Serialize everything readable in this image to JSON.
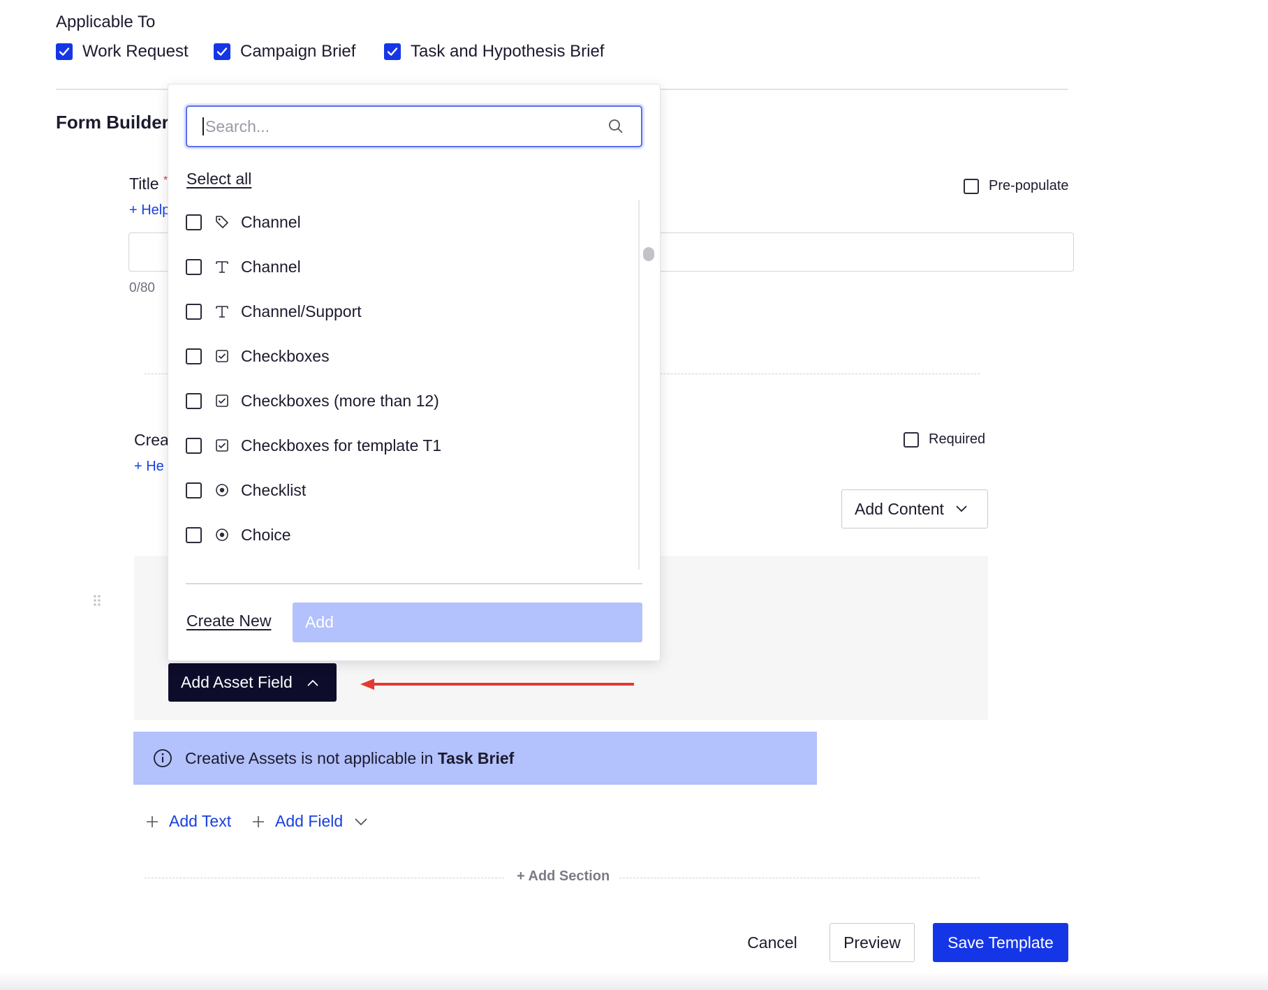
{
  "applicable_to": {
    "label": "Applicable To",
    "options": [
      {
        "label": "Work Request",
        "checked": true
      },
      {
        "label": "Campaign Brief",
        "checked": true
      },
      {
        "label": "Task and Hypothesis Brief",
        "checked": true
      }
    ]
  },
  "form_builder": {
    "title": "Form Builder",
    "title_field": {
      "label": "Title",
      "required_marker": "*",
      "help_link": "+ Help",
      "char_count": "0/80",
      "prepopulate_label": "Pre-populate"
    },
    "section": {
      "label": "Crea",
      "help_link": "+ He",
      "required_label": "Required",
      "add_content_label": "Add Content"
    },
    "add_asset_field_label": "Add Asset Field",
    "info_banner": {
      "text_prefix": "Creative Assets is not applicable in ",
      "text_bold": "Task Brief"
    },
    "add_text_label": "Add Text",
    "add_field_label": "Add Field",
    "add_section_label": "+ Add Section"
  },
  "dropdown": {
    "search_placeholder": "Search...",
    "select_all_label": "Select all",
    "items": [
      {
        "label": "Channel",
        "icon": "tag-icon"
      },
      {
        "label": "Channel",
        "icon": "text-icon"
      },
      {
        "label": "Channel/Support",
        "icon": "text-icon"
      },
      {
        "label": "Checkboxes",
        "icon": "checkbox-icon"
      },
      {
        "label": "Checkboxes (more than 12)",
        "icon": "checkbox-icon"
      },
      {
        "label": "Checkboxes for template T1",
        "icon": "checkbox-icon"
      },
      {
        "label": "Checklist",
        "icon": "radio-icon"
      },
      {
        "label": "Choice",
        "icon": "radio-icon"
      }
    ],
    "create_new_label": "Create New",
    "add_label": "Add"
  },
  "footer": {
    "cancel_label": "Cancel",
    "preview_label": "Preview",
    "save_label": "Save Template"
  },
  "colors": {
    "primary": "#1536e6",
    "dark_button": "#0d0d2b",
    "banner_bg": "#b3c1fc",
    "add_disabled_bg": "#b3c1fc",
    "annotation_arrow": "#e53935"
  }
}
